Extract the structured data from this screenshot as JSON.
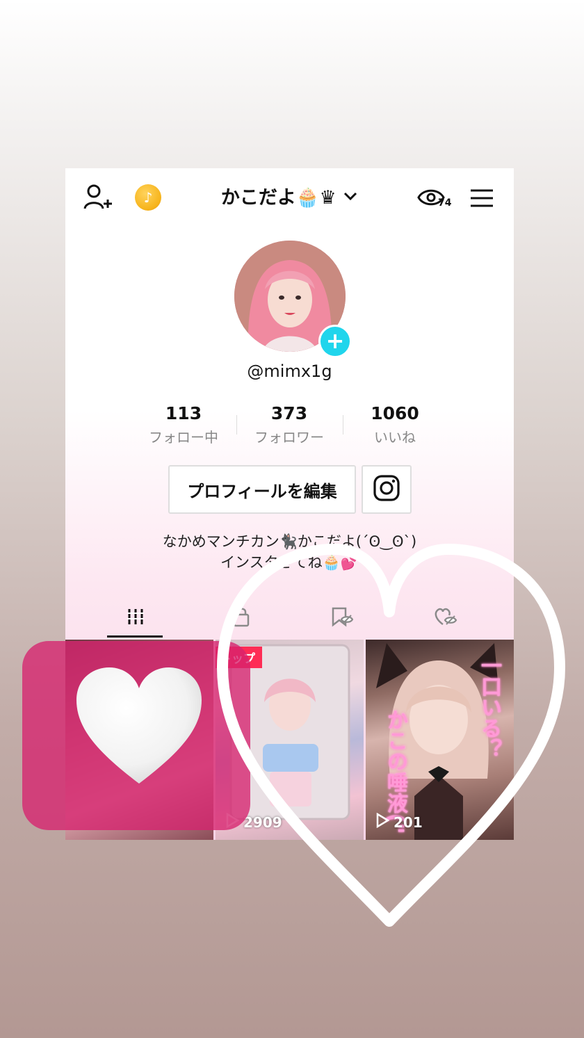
{
  "header": {
    "username_title": "かこだよ🧁♛",
    "view_count_badge": "74",
    "icons": {
      "add_friend": "add-friend-icon",
      "coin": "tiktok-coin-icon",
      "chevron": "chevron-down-icon",
      "profile_views": "eye-icon",
      "menu": "hamburger-menu-icon"
    }
  },
  "profile": {
    "handle": "@mimx1g",
    "stats": [
      {
        "value": "113",
        "label": "フォロー中"
      },
      {
        "value": "373",
        "label": "フォロワー"
      },
      {
        "value": "1060",
        "label": "いいね"
      }
    ],
    "edit_button_label": "プロフィールを編集",
    "bio_line1": "なかめマンチカン🐈‍⬛かこだよ(´ʘ‿ʘ`)",
    "bio_line2": "インスタきてね🧁💕"
  },
  "tabs": [
    {
      "name": "videos",
      "icon": "grid-icon",
      "active": true
    },
    {
      "name": "private",
      "icon": "lock-icon",
      "active": false
    },
    {
      "name": "saved",
      "icon": "bookmark-icon",
      "active": false
    },
    {
      "name": "liked",
      "icon": "heart-eye-icon",
      "active": false
    }
  ],
  "videos": [
    {
      "views": "",
      "pinned": false
    },
    {
      "views": "2909",
      "pinned": true,
      "pin_label": "トップ"
    },
    {
      "views": "201",
      "pinned": false,
      "overlay_line1": "一口いる？",
      "overlay_line2": "かこの唾液(\""
    }
  ],
  "stickers": {
    "white_heart": "white-heart-sticker",
    "outline_heart": "heart-outline-sticker"
  },
  "colors": {
    "accent_pink": "#fe2c55",
    "add_badge": "#20d5ec",
    "sticker_pink": "#d6226e"
  }
}
